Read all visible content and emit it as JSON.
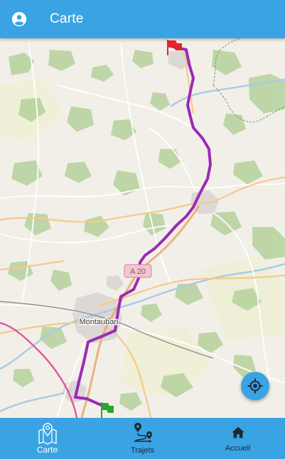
{
  "app_bar": {
    "title": "Carte",
    "account_icon": "account-circle-icon"
  },
  "map": {
    "labels": {
      "city": "Montauban",
      "motorway_shield": "A 20"
    },
    "route_color": "#9b2bb3",
    "start_flag_color": "#2aa52e",
    "end_flag_color": "#e2242b"
  },
  "locate_button": {
    "icon": "crosshair-gps-icon"
  },
  "bottom_nav": {
    "items": [
      {
        "label": "Carte",
        "icon": "map-pin-icon",
        "active": true
      },
      {
        "label": "Trajets",
        "icon": "route-icon",
        "active": false
      },
      {
        "label": "Accueil",
        "icon": "home-icon",
        "active": false
      }
    ]
  },
  "colors": {
    "primary": "#3aa3e3",
    "active_nav_text": "#ffffff",
    "inactive_nav_text": "#1d2a36"
  }
}
